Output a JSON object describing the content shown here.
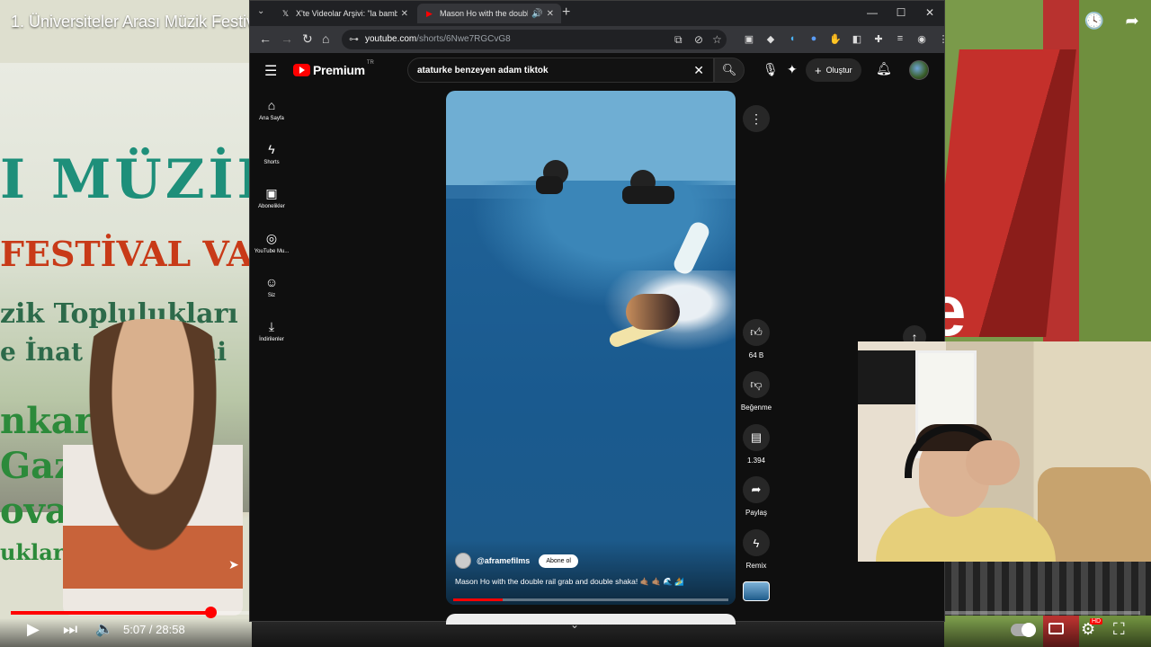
{
  "background_video": {
    "title": "1. Üniversiteler Arası Müzik Festiv",
    "banner_lines": [
      "I MÜZİK",
      "FESTİVAL VA",
      "zik Toplulukları",
      "e İnat Şenliğimi",
      "nkara",
      "Gazi",
      "ova Kü",
      "ukları"
    ],
    "time": "5:07 / 28:58",
    "progress_fraction": 0.177,
    "hd_badge": "HD"
  },
  "browser": {
    "tabs": [
      {
        "label": "X'te Videolar Arşivi: \"la bamba |",
        "icon": "x-logo-icon"
      },
      {
        "label": "Mason Ho with the double",
        "icon": "youtube-icon",
        "active": true
      }
    ],
    "url_domain": "youtube.com",
    "url_path": "/shorts/6Nwe7RGCvG8"
  },
  "youtube": {
    "logo_text": "Premium",
    "region": "TR",
    "search_query": "ataturke benzeyen adam tiktok",
    "create_label": "Oluştur",
    "sidebar": [
      {
        "label": "Ana Sayfa",
        "icon": "home-icon"
      },
      {
        "label": "Shorts",
        "icon": "shorts-icon"
      },
      {
        "label": "Abonelikler",
        "icon": "subscriptions-icon"
      },
      {
        "label": "YouTube Mu...",
        "icon": "youtube-music-icon"
      },
      {
        "label": "Siz",
        "icon": "profile-icon"
      },
      {
        "label": "İndirilenler",
        "icon": "download-icon"
      }
    ],
    "short": {
      "channel": "@aframefilms",
      "subscribe_label": "Abone ol",
      "caption": "Mason Ho with the double rail grab and double shaka! 🤙🏽 🤙🏽 🌊 🏄",
      "progress_fraction": 0.18,
      "actions": {
        "like": "64 B",
        "dislike": "Beğenme",
        "comments": "1.394",
        "share": "Paylaş",
        "remix": "Remix"
      }
    }
  },
  "colors": {
    "youtube_red": "#ff0000",
    "yt_background": "#0f0f0f",
    "chrome_tabbar": "#202124",
    "chrome_toolbar": "#35363a"
  }
}
